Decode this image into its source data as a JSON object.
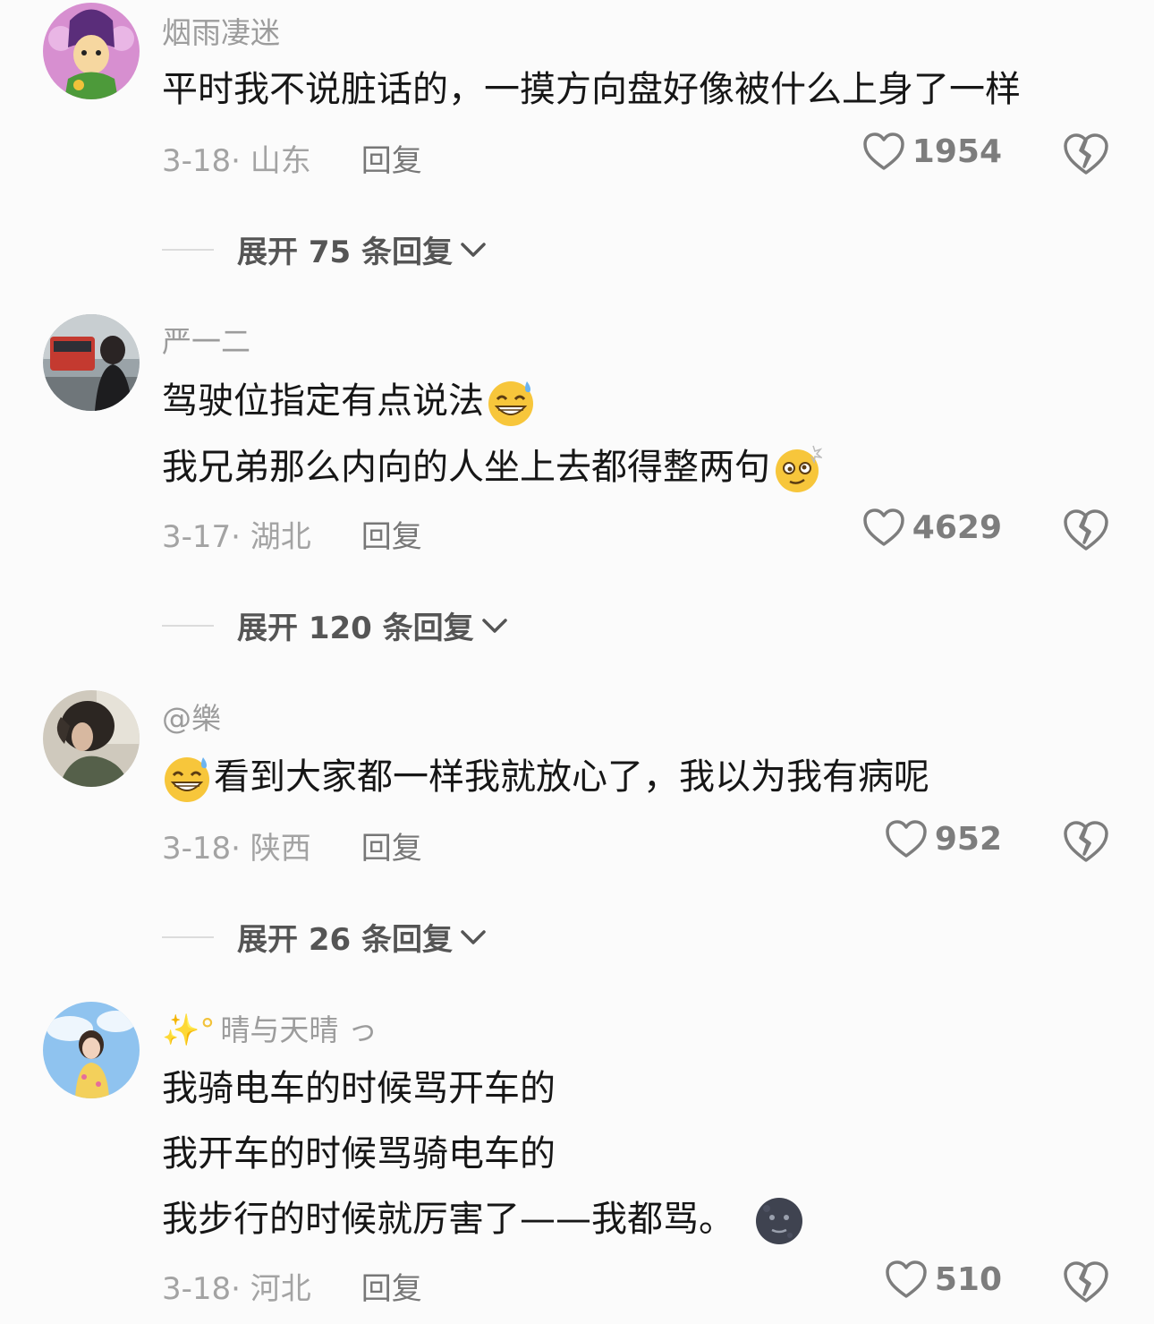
{
  "comments": [
    {
      "username": "烟雨凄迷",
      "lines": [
        "平时我不说脏话的，一摸方向盘好像被什么上身了一样"
      ],
      "date": "3-18",
      "location": "· 山东",
      "reply_label": "回复",
      "likes": "1954",
      "expand_label": "展开 75 条回复"
    },
    {
      "username": "严一二",
      "lines": [
        "驾驶位指定有点说法",
        "我兄弟那么内向的人坐上去都得整两句"
      ],
      "emojis": [
        "grin-sweat-emoji",
        "dizzy-face-emoji"
      ],
      "date": "3-17",
      "location": "· 湖北",
      "reply_label": "回复",
      "likes": "4629",
      "expand_label": "展开 120 条回复"
    },
    {
      "username": "@樂",
      "lines": [
        "看到大家都一样我就放心了，我以为我有病呢"
      ],
      "emojis": [
        "grin-sweat-emoji"
      ],
      "date": "3-18",
      "location": "· 陕西",
      "reply_label": "回复",
      "likes": "952",
      "expand_label": "展开 26 条回复"
    },
    {
      "username_prefix": "✨°",
      "username": "晴与天晴 っ",
      "lines": [
        "我骑电车的时候骂开车的",
        "我开车的时候骂骑电车的",
        "我步行的时候就厉害了——我都骂。"
      ],
      "emojis": [
        "new-moon-face-emoji"
      ],
      "date": "3-18",
      "location": "· 河北",
      "reply_label": "回复",
      "likes": "510"
    }
  ],
  "colors": {
    "background": "#fbfbfb",
    "username": "#9c9c9c",
    "text": "#161616",
    "meta": "#a3a3a3"
  }
}
